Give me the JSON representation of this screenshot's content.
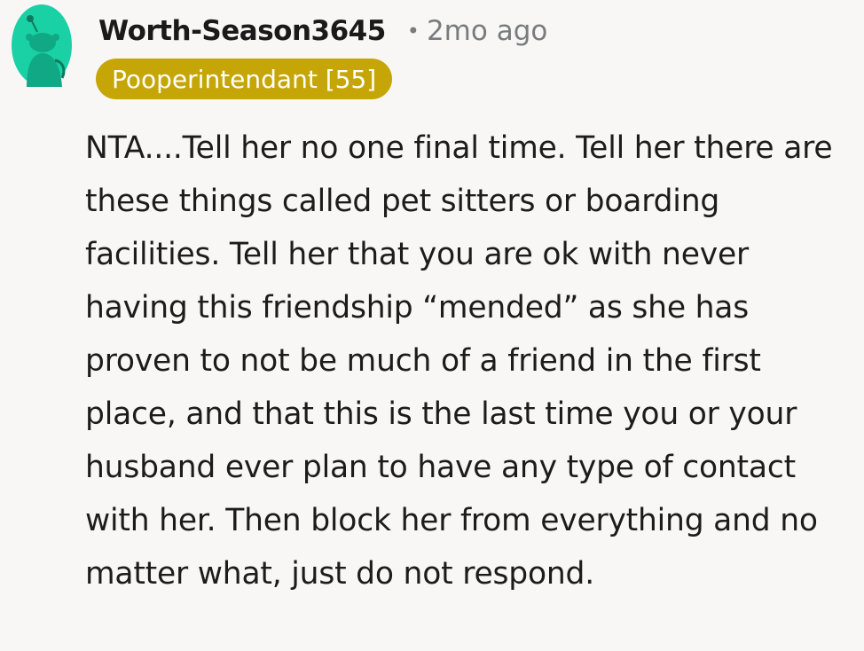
{
  "comment": {
    "avatar_icon": "reddit-snoo-avatar-icon",
    "avatar_color": "#1ad1a5",
    "username": "Worth-Season3645",
    "separator": "•",
    "timestamp": "2mo ago",
    "flair": {
      "label": "Pooperintendant [55]",
      "color": "#c5a606",
      "text_color": "#ffffff"
    },
    "body": "NTA....Tell her no one final time. Tell her there are these things called pet sitters or boarding facilities. Tell her that you are ok with never having this friendship “mended” as she has proven to not be much of a friend in the first place, and that this is the last time you or your husband ever plan to have any type of contact with her. Then block her from everything and no matter what, just do not respond."
  }
}
